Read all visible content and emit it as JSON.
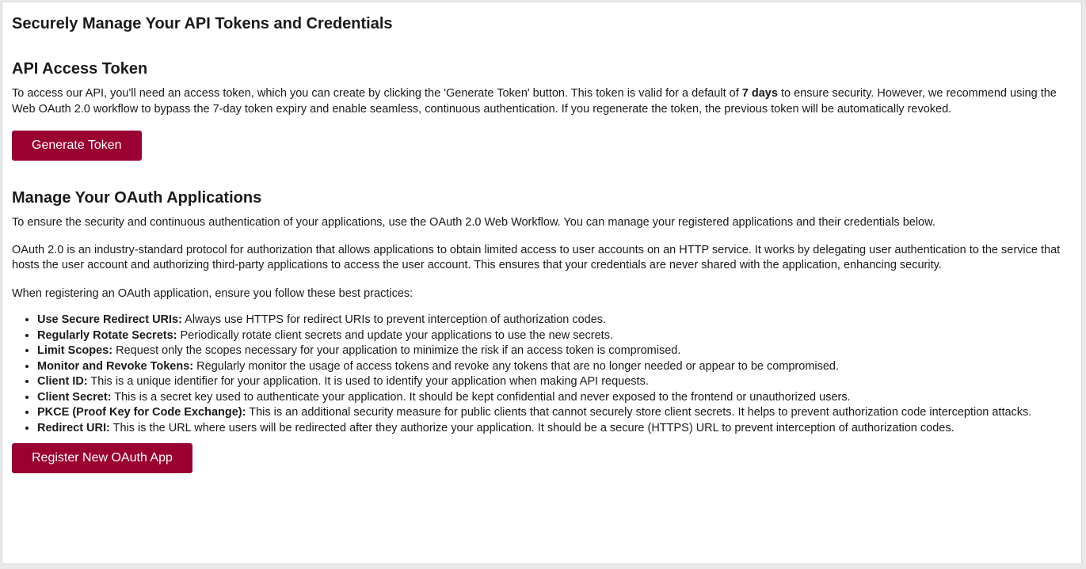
{
  "page": {
    "title": "Securely Manage Your API Tokens and Credentials"
  },
  "api_token": {
    "heading": "API Access Token",
    "description_before": "To access our API, you'll need an access token, which you can create by clicking the 'Generate Token' button. This token is valid for a default of ",
    "description_emphasis": "7 days",
    "description_after": " to ensure security. However, we recommend using the Web OAuth 2.0 workflow to bypass the 7-day token expiry and enable seamless, continuous authentication. If you regenerate the token, the previous token will be automatically revoked.",
    "button_label": "Generate Token"
  },
  "oauth": {
    "heading": "Manage Your OAuth Applications",
    "intro": "To ensure the security and continuous authentication of your applications, use the OAuth 2.0 Web Workflow. You can manage your registered applications and their credentials below.",
    "description": "OAuth 2.0 is an industry-standard protocol for authorization that allows applications to obtain limited access to user accounts on an HTTP service. It works by delegating user authentication to the service that hosts the user account and authorizing third-party applications to access the user account. This ensures that your credentials are never shared with the application, enhancing security.",
    "practices_intro": "When registering an OAuth application, ensure you follow these best practices:",
    "practices": [
      {
        "term": "Use Secure Redirect URIs:",
        "text": " Always use HTTPS for redirect URIs to prevent interception of authorization codes."
      },
      {
        "term": "Regularly Rotate Secrets:",
        "text": " Periodically rotate client secrets and update your applications to use the new secrets."
      },
      {
        "term": "Limit Scopes:",
        "text": " Request only the scopes necessary for your application to minimize the risk if an access token is compromised."
      },
      {
        "term": "Monitor and Revoke Tokens:",
        "text": " Regularly monitor the usage of access tokens and revoke any tokens that are no longer needed or appear to be compromised."
      },
      {
        "term": "Client ID:",
        "text": " This is a unique identifier for your application. It is used to identify your application when making API requests."
      },
      {
        "term": "Client Secret:",
        "text": " This is a secret key used to authenticate your application. It should be kept confidential and never exposed to the frontend or unauthorized users."
      },
      {
        "term": "PKCE (Proof Key for Code Exchange):",
        "text": " This is an additional security measure for public clients that cannot securely store client secrets. It helps to prevent authorization code interception attacks."
      },
      {
        "term": "Redirect URI:",
        "text": " This is the URL where users will be redirected after they authorize your application. It should be a secure (HTTPS) URL to prevent interception of authorization codes."
      }
    ],
    "button_label": "Register New OAuth App"
  },
  "colors": {
    "accent": "#9b0032",
    "text": "#1a1a1a",
    "panel_background": "#ffffff",
    "page_background": "#e9e9e9"
  }
}
